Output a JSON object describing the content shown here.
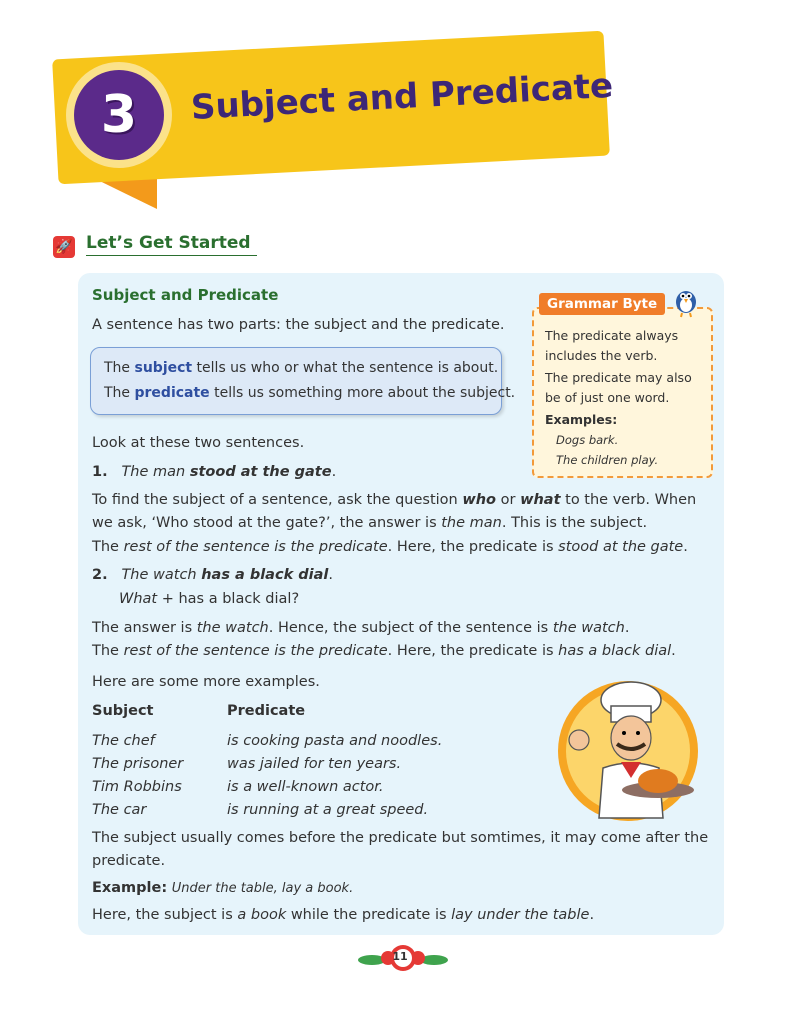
{
  "chapter": {
    "number": "3",
    "title": "Subject and Predicate"
  },
  "section": {
    "heading": "Let’s Get Started"
  },
  "main": {
    "subheading": "Subject and Predicate",
    "intro": "A sentence has two parts: the subject and the predicate.",
    "definitions": [
      {
        "pre": "The ",
        "term": "subject",
        "post": " tells us who or what the sentence is about."
      },
      {
        "pre": "The ",
        "term": "predicate",
        "post": " tells us something more about the subject."
      }
    ],
    "look": "Look at these two sentences.",
    "ex1": {
      "num": "1.",
      "part1": "The man ",
      "part2": "stood at the gate",
      "part3": "."
    },
    "p1": {
      "a": "To find the subject of a sentence, ask the question ",
      "b": "who",
      "c": " or ",
      "d": "what",
      "e": " to the verb. When"
    },
    "p2": {
      "a": "we ask, ‘Who stood at the gate?’, the answer is ",
      "b": "the man",
      "c": ". This is the subject."
    },
    "p3": {
      "a": "The ",
      "b": "rest of the sentence is the predicate",
      "c": ". Here, the predicate is ",
      "d": "stood at the gate",
      "e": "."
    },
    "ex2": {
      "num": "2.",
      "part1": "The watch ",
      "part2": "has a black dial",
      "part3": ".",
      "q1": "What",
      "q2": " + has a black dial?"
    },
    "p4": {
      "a": "The answer is ",
      "b": "the watch",
      "c": ". Hence, the subject of the sentence is ",
      "d": "the watch",
      "e": "."
    },
    "p5": {
      "a": "The ",
      "b": "rest of the sentence is the predicate",
      "c": ". Here, the predicate is ",
      "d": "has a black dial",
      "e": "."
    },
    "more": "Here are some more examples.",
    "table": {
      "headers": [
        "Subject",
        "Predicate"
      ],
      "rows": [
        [
          "The chef",
          "is cooking pasta and noodles."
        ],
        [
          "The prisoner",
          "was jailed for ten years."
        ],
        [
          "Tim Robbins",
          "is a well-known actor."
        ],
        [
          "The car",
          "is running at a great speed."
        ]
      ]
    },
    "p6a": "The subject usually comes before the predicate but somtimes, it may come after the",
    "p6b": "predicate.",
    "example": {
      "label": "Example:",
      "text": "Under the table, lay a book."
    },
    "p7": {
      "a": "Here, the subject is ",
      "b": "a book",
      "c": " while the predicate is ",
      "d": "lay under the table",
      "e": "."
    }
  },
  "grammar_byte": {
    "label": "Grammar Byte",
    "lines": [
      "The predicate always",
      "includes the verb.",
      "The predicate may also",
      "be of just one word."
    ],
    "examples_label": "Examples:",
    "examples": [
      "Dogs bark.",
      "The children play."
    ]
  },
  "page_number": "11"
}
